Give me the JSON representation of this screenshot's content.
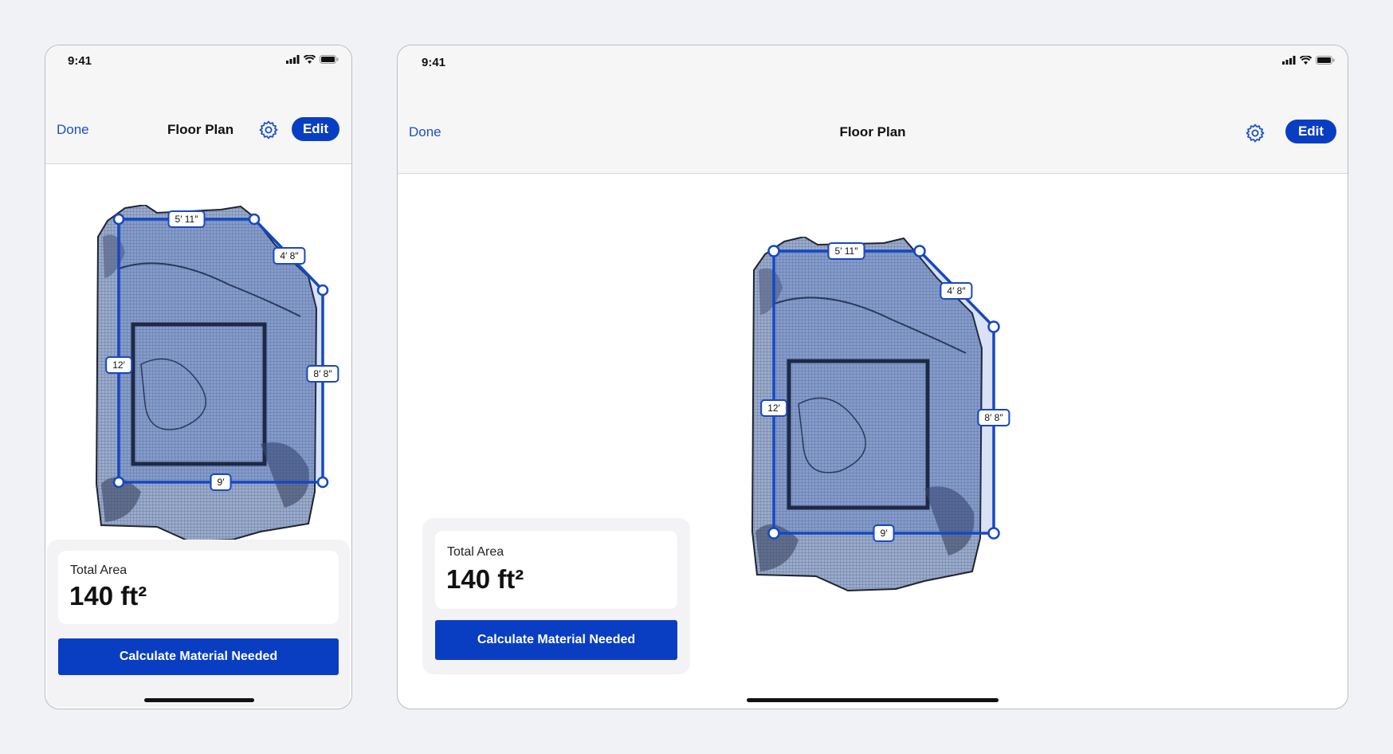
{
  "status": {
    "time": "9:41"
  },
  "nav": {
    "done": "Done",
    "title": "Floor Plan",
    "edit": "Edit"
  },
  "measurements": {
    "top": "5′ 11″",
    "diagonal": "4′ 8″",
    "left": "12′",
    "right": "8′ 8″",
    "bottom": "9′"
  },
  "summary": {
    "label": "Total Area",
    "value": "140 ft²"
  },
  "action": {
    "calculate": "Calculate Material Needed"
  },
  "colors": {
    "accent": "#0a3ec2",
    "outline": "#1748c2",
    "fill": "#8fa3c8"
  }
}
